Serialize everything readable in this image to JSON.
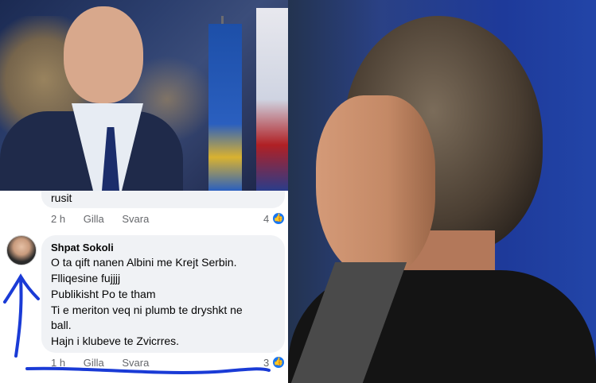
{
  "previous_comment": {
    "text_tail": "rusit",
    "time": "2 h",
    "like_label": "Gilla",
    "reply_label": "Svara",
    "reaction_count": "4"
  },
  "comment": {
    "author": "Shpat Sokoli",
    "lines": [
      "O ta qift nanen Albini me Krejt Serbin.",
      "Flliqesine fujjjj",
      "Publikisht Po te tham",
      "Ti e meriton veq ni plumb te dryshkt ne",
      "ball.",
      "Hajn i klubeve te Zvicrres."
    ],
    "time": "1 h",
    "like_label": "Gilla",
    "reply_label": "Svara",
    "reaction_count": "3"
  },
  "icons": {
    "reaction": "thumbs-up-icon",
    "annotation_arrow": "hand-drawn-arrow",
    "annotation_underline": "hand-drawn-underline"
  },
  "colors": {
    "facebook_blue": "#1877f2",
    "bubble_bg": "#f0f2f5",
    "meta_text": "#65676b",
    "annotation_blue": "#1a3bd6"
  }
}
